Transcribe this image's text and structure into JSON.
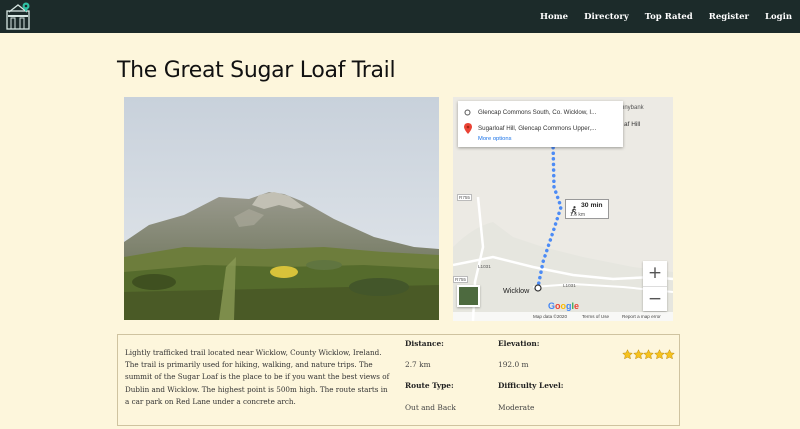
{
  "nav": {
    "links": [
      "Home",
      "Directory",
      "Top Rated",
      "Register",
      "Login"
    ]
  },
  "trail": {
    "title": "The Great Sugar Loaf Trail",
    "description": "Lightly trafficked trail located near Wicklow, County Wicklow, Ireland. The trail is primarily used for hiking, walking, and nature trips. The summit of the Sugar Loaf is the place to be if you want the best views of Dublin and Wicklow. The highest point is 500m high. The route starts in a car park on Red Lane under a concrete arch.",
    "distance_label": "Distance:",
    "distance_value": "2.7 km",
    "elevation_label": "Elevation:",
    "elevation_value": "192.0 m",
    "route_type_label": "Route Type:",
    "route_type_value": "Out and Back",
    "difficulty_label": "Difficulty Level:",
    "difficulty_value": "Moderate",
    "rating_stars": 5
  },
  "map": {
    "origin": "Glencap Commons South, Co. Wicklow, I...",
    "destination": "Sugarloaf Hill, Glencap Commons Upper,...",
    "more_options": "More options",
    "duration": "30 min",
    "duration_distance": "1.6 km",
    "place_label": "Wicklow",
    "peak_label": "af Hill",
    "area_label": "nnybank",
    "road_r755": "R755",
    "road_r755b": "R755",
    "road_l1031": "L1031",
    "road_l1031b": "L1031",
    "google": "Google",
    "footer_data": "Map data ©2020",
    "footer_terms": "Terms of Use",
    "footer_report": "Report a map error",
    "zoom_in": "+",
    "zoom_out": "−",
    "colors": {
      "route": "#4c8bf5",
      "pin": "#ea4335"
    }
  },
  "colors": {
    "navbar": "#1c2b2a",
    "background": "#fdf6dc",
    "star": "#f6c21e"
  }
}
